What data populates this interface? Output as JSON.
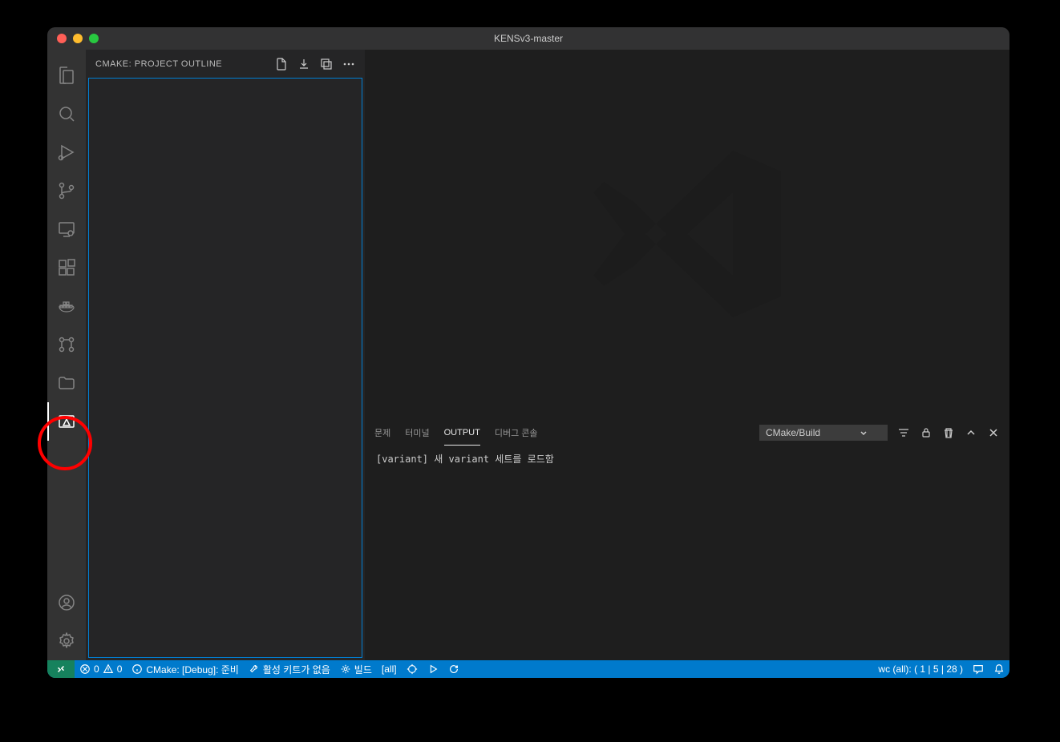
{
  "window": {
    "title": "KENSv3-master"
  },
  "activitybar": {
    "items": [
      {
        "name": "explorer-icon",
        "label": "Explorer"
      },
      {
        "name": "search-icon",
        "label": "Search"
      },
      {
        "name": "run-debug-icon",
        "label": "Run and Debug"
      },
      {
        "name": "source-control-icon",
        "label": "Source Control"
      },
      {
        "name": "remote-explorer-icon",
        "label": "Remote Explorer"
      },
      {
        "name": "extensions-icon",
        "label": "Extensions"
      },
      {
        "name": "docker-icon",
        "label": "Docker"
      },
      {
        "name": "git-graph-icon",
        "label": "Git Graph"
      },
      {
        "name": "project-manager-icon",
        "label": "Project Manager"
      },
      {
        "name": "cmake-icon",
        "label": "CMake",
        "active": true
      }
    ],
    "bottom": [
      {
        "name": "accounts-icon",
        "label": "Accounts"
      },
      {
        "name": "settings-gear-icon",
        "label": "Settings"
      }
    ]
  },
  "sidebar": {
    "title": "CMAKE: PROJECT OUTLINE",
    "actions": [
      {
        "name": "new-file-icon"
      },
      {
        "name": "save-icon"
      },
      {
        "name": "collapse-icon"
      },
      {
        "name": "more-icon"
      }
    ]
  },
  "panel": {
    "tabs": [
      {
        "label": "문제",
        "name": "problems-tab"
      },
      {
        "label": "터미널",
        "name": "terminal-tab"
      },
      {
        "label": "OUTPUT",
        "name": "output-tab",
        "active": true
      },
      {
        "label": "디버그 콘솔",
        "name": "debug-console-tab"
      }
    ],
    "selector": "CMake/Build",
    "output_text": "[variant] 새 variant 세트를 로드함"
  },
  "statusbar": {
    "errors": "0",
    "warnings": "0",
    "cmake_status": "CMake: [Debug]: 준비",
    "kit_status": "활성 키트가 없음",
    "build_label": "빌드",
    "target": "[all]",
    "wc_status": "wc (all): ( 1 | 5 | 28 )"
  }
}
